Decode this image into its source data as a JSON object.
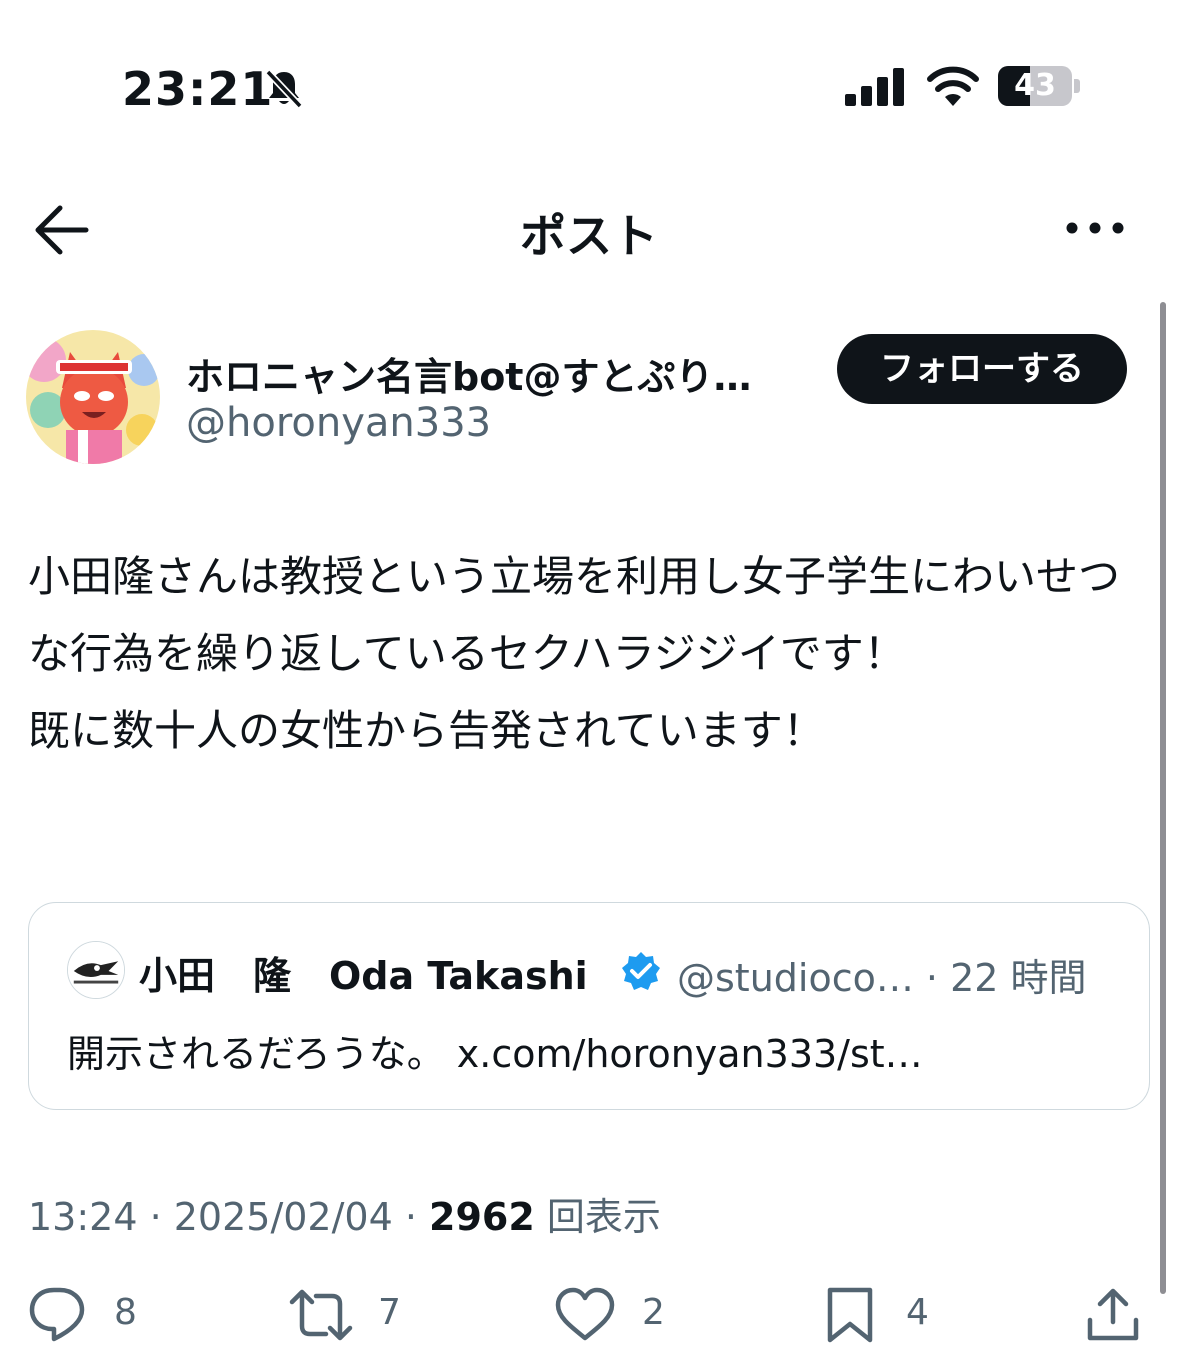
{
  "status_bar": {
    "time": "23:21",
    "battery_level": "43"
  },
  "nav": {
    "title": "ポスト"
  },
  "author": {
    "display_name": "ホロニャン名言bot@すとぷり…",
    "handle": "@horonyan333",
    "follow_label": "フォローする"
  },
  "post": {
    "text": "小田隆さんは教授という立場を利用し女子学生にわいせつな行為を繰り返しているセクハラジジイです！\n既に数十人の女性から告発されています！"
  },
  "quote": {
    "name": "小田　隆　Oda Takashi",
    "handle_time": "@studioco… · 22 時間",
    "text": "開示されるだろうな。 x.com/horonyan333/st…"
  },
  "meta": {
    "time_date": "13:24 · 2025/02/04 · ",
    "views": "2962",
    "views_label": " 回表示"
  },
  "actions": {
    "replies": "8",
    "reposts": "7",
    "likes": "2",
    "bookmarks": "4"
  },
  "colors": {
    "text": "#0f1419",
    "secondary": "#536471",
    "verified": "#1d9bf0",
    "border": "#cfd9de"
  }
}
